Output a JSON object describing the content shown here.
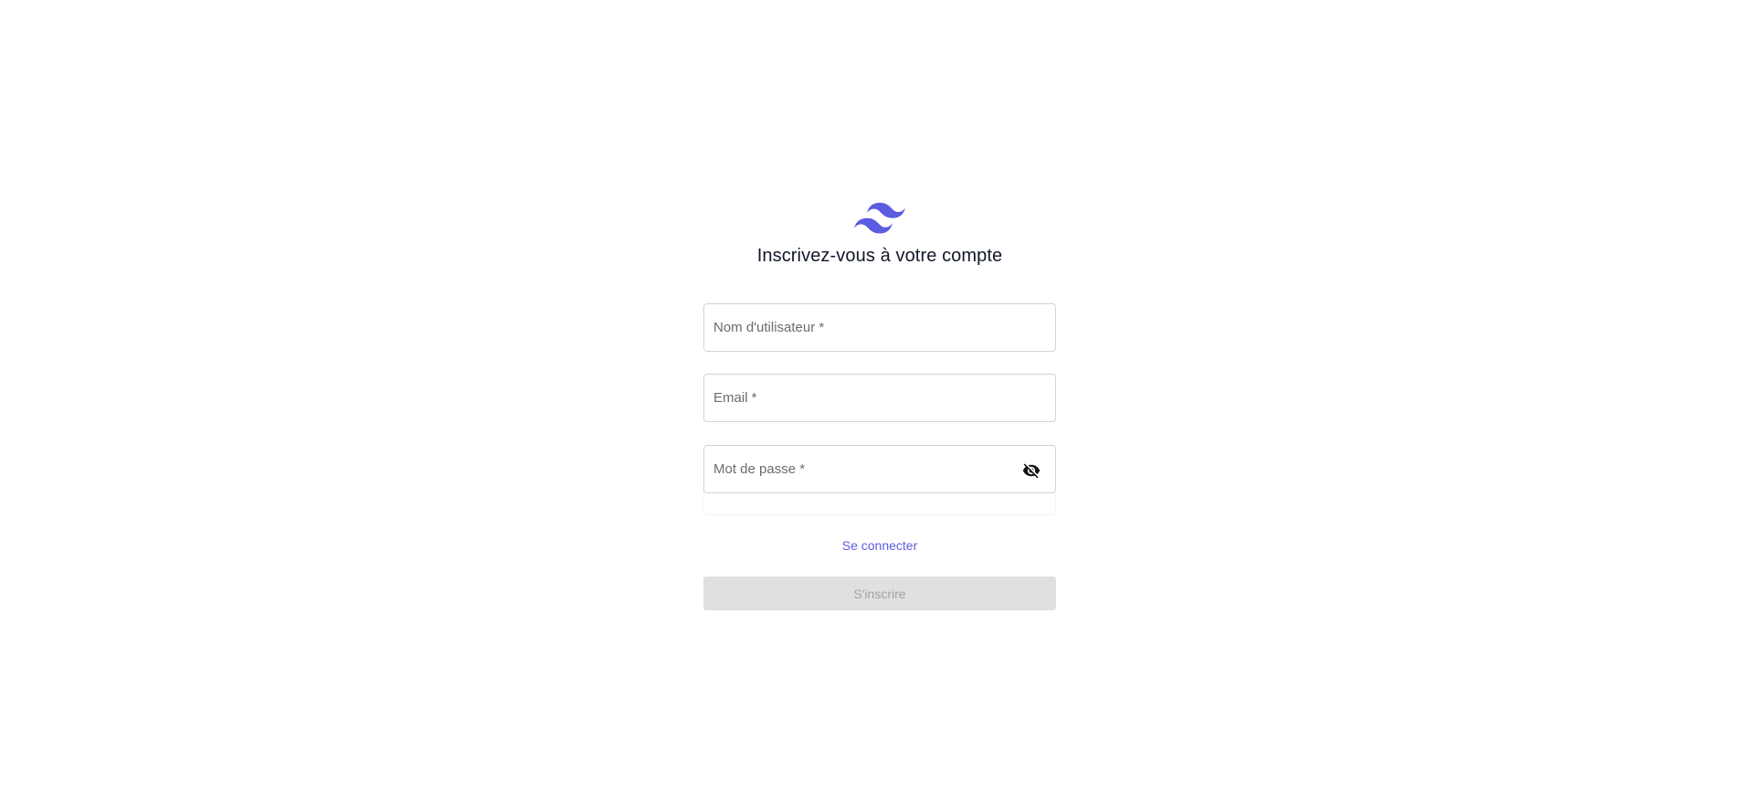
{
  "colors": {
    "brand": "#5b5ce2",
    "title": "#111827",
    "button_disabled_bg": "#e0e0e0",
    "button_disabled_text": "#a3a3a3"
  },
  "logo": {
    "icon": "tailwind-waves-icon"
  },
  "title": "Inscrivez-vous à votre compte",
  "form": {
    "username": {
      "placeholder": "Nom d'utilisateur *",
      "value": ""
    },
    "email": {
      "placeholder": "Email *",
      "value": ""
    },
    "password": {
      "placeholder": "Mot de passe *",
      "value": "",
      "toggle_icon": "eye-off-icon"
    }
  },
  "login_link": "Se connecter",
  "submit_label": "S'inscrire"
}
